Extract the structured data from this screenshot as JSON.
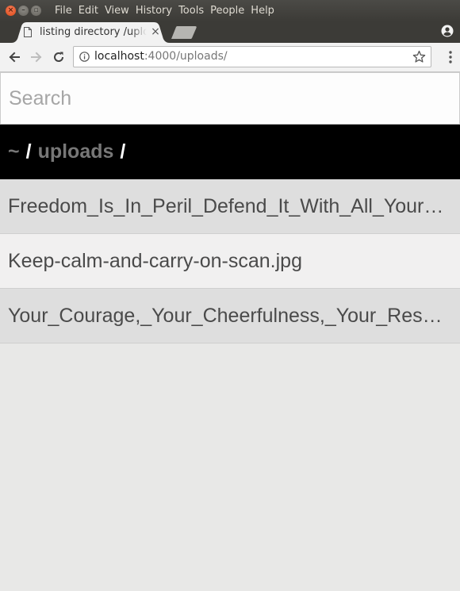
{
  "window": {
    "menu": [
      "File",
      "Edit",
      "View",
      "History",
      "Tools",
      "People",
      "Help"
    ]
  },
  "tab": {
    "title": "listing directory /uploads/",
    "close_glyph": "×"
  },
  "omnibox": {
    "host": "localhost",
    "rest": ":4000/uploads/"
  },
  "icons": {
    "back": "back-arrow-icon",
    "forward": "forward-arrow-icon",
    "reload": "reload-icon",
    "info": "info-icon",
    "star": "star-icon",
    "menu": "kebab-menu-icon",
    "profile": "profile-icon",
    "page": "page-icon"
  },
  "search": {
    "placeholder": "Search",
    "value": ""
  },
  "breadcrumb": {
    "home": "~",
    "separator": "/",
    "current": "uploads"
  },
  "files": [
    "Freedom_Is_In_Peril_Defend_It_With_All_Your_Might.jpg",
    "Keep-calm-and-carry-on-scan.jpg",
    "Your_Courage,_Your_Cheerfulness,_Your_Resolution_Will_Bring_Us_Victory.jpg"
  ],
  "colors": {
    "breadcrumb_bg": "#000000",
    "link": "#777777",
    "row_odd": "#dedede",
    "row_even": "#f1f0f0",
    "page_bg": "#e8e8e7"
  }
}
